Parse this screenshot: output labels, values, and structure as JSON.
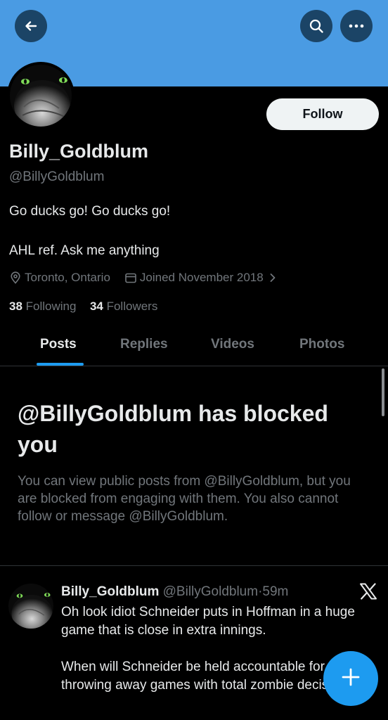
{
  "header": {
    "back_icon": "arrow-left-icon",
    "search_icon": "search-icon",
    "more_icon": "more-horizontal-icon",
    "banner_color": "#4a9be3"
  },
  "profile": {
    "follow_label": "Follow",
    "display_name": "Billy_Goldblum",
    "handle": "@BillyGoldblum",
    "bio_line1": "Go ducks go! Go ducks go!",
    "bio_line2": "AHL ref. Ask me anything",
    "location": "Toronto, Ontario",
    "joined": "Joined November 2018",
    "following_count": "38",
    "following_label": "Following",
    "followers_count": "34",
    "followers_label": "Followers"
  },
  "tabs": [
    {
      "label": "Posts",
      "active": true
    },
    {
      "label": "Replies",
      "active": false
    },
    {
      "label": "Videos",
      "active": false
    },
    {
      "label": "Photos",
      "active": false
    }
  ],
  "blocked": {
    "title": "@BillyGoldblum has blocked you",
    "body": "You can view public posts from @BillyGoldblum, but you are blocked from engaging with them. You also cannot follow or message @BillyGoldblum."
  },
  "post": {
    "author_name": "Billy_Goldblum",
    "author_handle": "@BillyGoldblum",
    "separator": "·",
    "time": "59m",
    "paragraph1": "Oh look idiot Schneider puts in Hoffman in a huge game that is close in extra innings.",
    "paragraph2": "When will Schneider be held accountable for throwing away games with total zombie decisions?"
  },
  "colors": {
    "accent": "#1d9bf0",
    "muted_text": "#71767b",
    "primary_text": "#e7e9ea",
    "divider": "#2f3336"
  }
}
